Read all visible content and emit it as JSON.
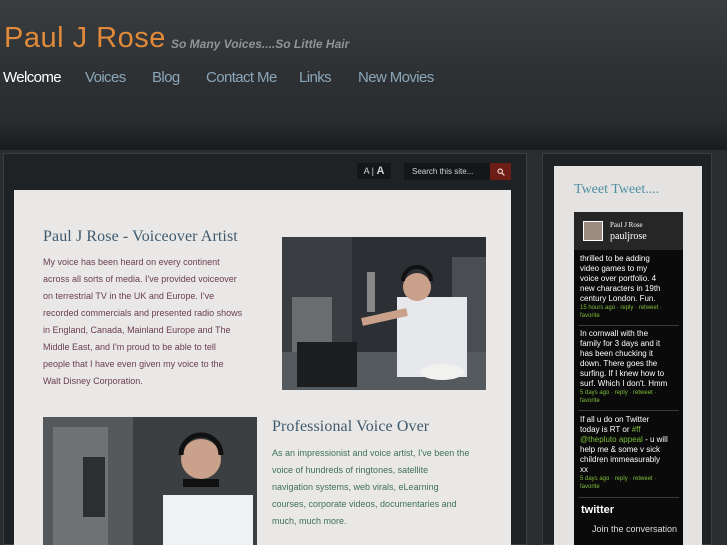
{
  "header": {
    "site_title": "Paul J Rose",
    "tagline": "So Many Voices....So Little Hair"
  },
  "nav": [
    {
      "label": "Welcome",
      "active": true
    },
    {
      "label": "Voices",
      "active": false
    },
    {
      "label": "Blog",
      "active": false
    },
    {
      "label": "Contact Me",
      "active": false
    },
    {
      "label": "Links",
      "active": false
    },
    {
      "label": "New Movies",
      "active": false
    }
  ],
  "toolbar": {
    "font_small": "A",
    "font_separator": "|",
    "font_large": "A",
    "search_placeholder": "Search this site..."
  },
  "content": {
    "section1_title": "Paul J Rose - Voiceover Artist",
    "section1_lines": [
      "My voice has been heard on every continent",
      "across all sorts of media. I've provided voiceover",
      "on terrestrial TV in the UK and Europe. I've",
      "recorded commercials and presented radio shows",
      "in England, Canada, Mainland Europe and The",
      "Middle East, and I'm proud to be able to tell",
      "people that I have even given my voice to the",
      "Walt Disney Corporation."
    ],
    "section2_title": "Professional Voice Over",
    "section2_lines": [
      "As an impressionist and voice artist, I've been the",
      "voice of hundreds of ringtones, satellite",
      "navigation systems, web virals, eLearning",
      "courses, corporate videos, documentaries and",
      "much, much more."
    ]
  },
  "sidebar": {
    "title": "Tweet Tweet....",
    "twitter": {
      "name": "Paul J Rose",
      "handle": "pauljrose",
      "tweets": [
        {
          "lines": [
            "thrilled to be adding",
            "video games to my",
            "voice over portfolio. 4",
            "new characters in 19th",
            "century London. Fun."
          ],
          "meta_lines": [
            "15 hours ago · reply · retweet ·",
            "favorite"
          ]
        },
        {
          "lines": [
            "In cornwall with the",
            "family for 3 days and it",
            "has been chucking it",
            "down. There goes the",
            "surfing. If I knew how to",
            "surf. Which I don't. Hmm"
          ],
          "meta_lines": [
            "5 days ago · reply · retweet ·",
            "favorite"
          ]
        },
        {
          "line1": "If all u do on Twitter",
          "line2a": "today is RT or ",
          "hashtag": "#ff",
          "mention": "@thepluto appeal",
          "line3b": " - u will",
          "lines_rest": [
            "help me & some v sick",
            "children immeasurably",
            "xx"
          ],
          "meta_lines": [
            "5 days ago · reply · retweet ·",
            "favorite"
          ]
        }
      ],
      "logo_text": "twitter",
      "join_text": "Join the conversation"
    }
  },
  "colors": {
    "title_orange": "#e08a3a",
    "nav_blue": "#8aa6b8",
    "heading_blue": "#3f5a6e",
    "text_plum": "#6b3d52",
    "text_green": "#41705e",
    "tweet_green": "#7fbd3b",
    "search_button": "#6e1c16"
  }
}
